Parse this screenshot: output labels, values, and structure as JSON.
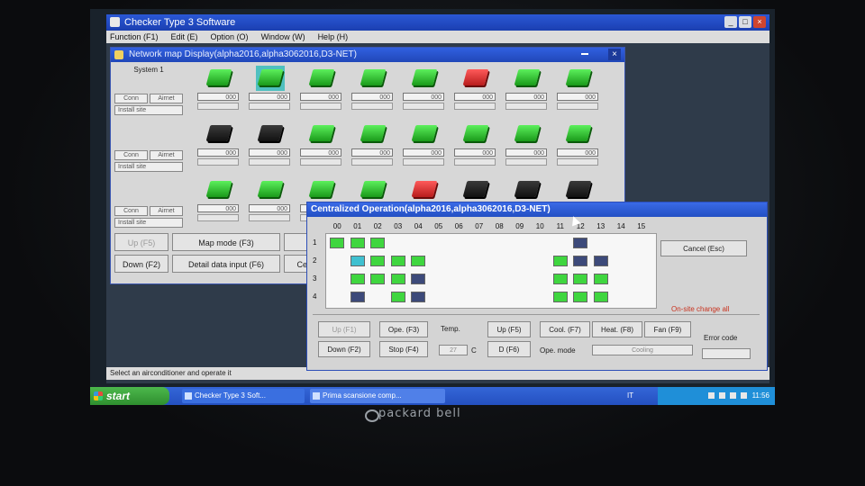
{
  "app": {
    "title": "Checker Type 3 Software",
    "menu": [
      "Function (F1)",
      "Edit (E)",
      "Option (O)",
      "Window (W)",
      "Help (H)"
    ]
  },
  "netwin": {
    "title": "Network map Display(alpha2016,alpha3062016,D3-NET)",
    "system_label": "System 1",
    "stat_labels": [
      "Conn",
      "Airnet"
    ],
    "install_label": "Install site",
    "unit_value": "000",
    "rows": [
      [
        "green",
        "green",
        "green",
        "green",
        "green",
        "red",
        "green",
        "green"
      ],
      [
        "black",
        "black",
        "green",
        "green",
        "green",
        "green",
        "green",
        "green"
      ],
      [
        "green",
        "green",
        "green",
        "green",
        "red",
        "black",
        "black",
        "black"
      ]
    ],
    "selected_unit": [
      0,
      1
    ],
    "buttons": {
      "up": "Up (F5)",
      "map_mode": "Map mode (F3)",
      "d": "Di",
      "down": "Down (F2)",
      "detail": "Detail data input (F6)",
      "central": "Centrali"
    }
  },
  "dialog": {
    "title": "Centralized Operation(alpha2016,alpha3062016,D3-NET)",
    "columns": [
      "00",
      "01",
      "02",
      "03",
      "04",
      "05",
      "06",
      "07",
      "08",
      "09",
      "10",
      "11",
      "12",
      "13",
      "14",
      "15"
    ],
    "rows": [
      "1",
      "2",
      "3",
      "4"
    ],
    "cells": [
      {
        "r": 0,
        "c": 0,
        "color": "green"
      },
      {
        "r": 0,
        "c": 1,
        "color": "green"
      },
      {
        "r": 0,
        "c": 2,
        "color": "green"
      },
      {
        "r": 1,
        "c": 1,
        "color": "cyan"
      },
      {
        "r": 1,
        "c": 2,
        "color": "green"
      },
      {
        "r": 1,
        "c": 3,
        "color": "green"
      },
      {
        "r": 1,
        "c": 4,
        "color": "green"
      },
      {
        "r": 2,
        "c": 1,
        "color": "green"
      },
      {
        "r": 2,
        "c": 2,
        "color": "green"
      },
      {
        "r": 2,
        "c": 3,
        "color": "green"
      },
      {
        "r": 2,
        "c": 4,
        "color": "navy"
      },
      {
        "r": 3,
        "c": 1,
        "color": "navy"
      },
      {
        "r": 3,
        "c": 3,
        "color": "green"
      },
      {
        "r": 3,
        "c": 4,
        "color": "navy"
      },
      {
        "r": 0,
        "c": 12,
        "color": "navy"
      },
      {
        "r": 1,
        "c": 11,
        "color": "green"
      },
      {
        "r": 1,
        "c": 12,
        "color": "navy"
      },
      {
        "r": 1,
        "c": 13,
        "color": "navy"
      },
      {
        "r": 2,
        "c": 11,
        "color": "green"
      },
      {
        "r": 2,
        "c": 12,
        "color": "green"
      },
      {
        "r": 2,
        "c": 13,
        "color": "green"
      },
      {
        "r": 3,
        "c": 11,
        "color": "green"
      },
      {
        "r": 3,
        "c": 12,
        "color": "green"
      },
      {
        "r": 3,
        "c": 13,
        "color": "green"
      }
    ],
    "cancel": "Cancel (Esc)",
    "error_note": "On-site change all",
    "up": "Up (F1)",
    "down": "Down (F2)",
    "ope": "Ope. (F3)",
    "stop": "Stop (F4)",
    "temp_label": "Temp.",
    "temp_value": "27",
    "temp_unit": "C",
    "up_f5": "Up (F5)",
    "d_f6": "D (F6)",
    "cool": "Cool. (F7)",
    "heat": "Heat. (F8)",
    "fan": "Fan (F9)",
    "error_code_label": "Error code",
    "ope_mode_label": "Ope. mode",
    "ope_mode_value": "Cooling"
  },
  "statusbar": "Select an airconditioner and operate it",
  "taskbar": {
    "start": "start",
    "tasks": [
      "Checker Type 3 Soft...",
      "Prima scansione comp..."
    ],
    "tray_lang": "IT",
    "clock": "11:56"
  },
  "brand": "packard bell",
  "colors": {
    "green": "#3fd63f",
    "red": "#e03030",
    "navy": "#3d4a7a",
    "cyan": "#3fc0d0",
    "title_blue": "#2350c4"
  }
}
